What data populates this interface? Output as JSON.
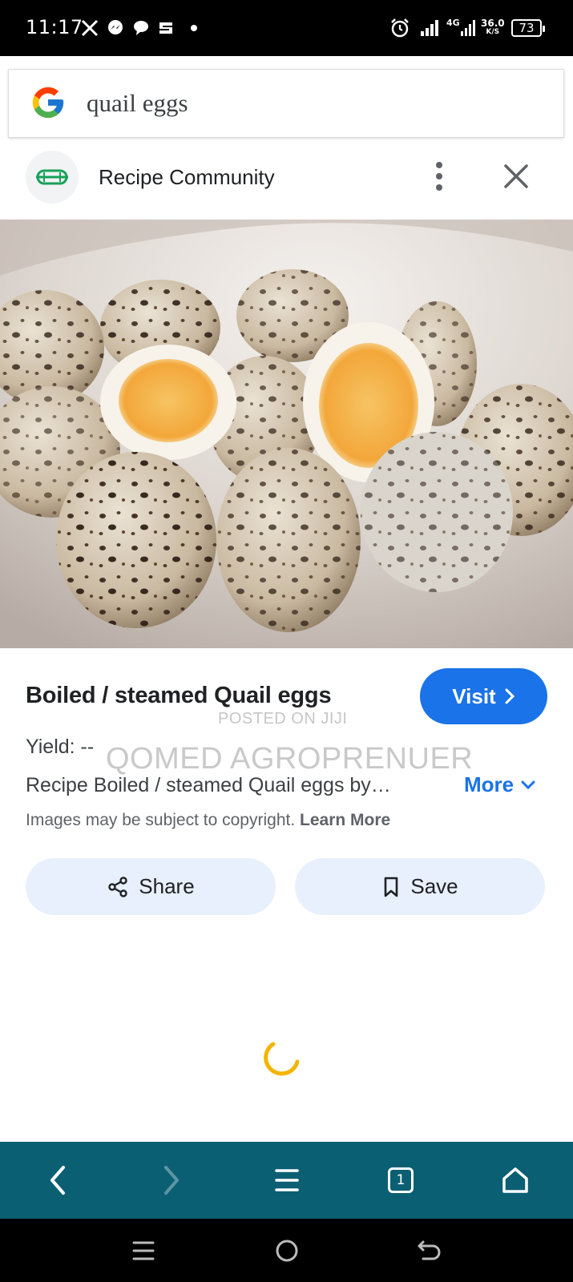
{
  "status_bar": {
    "time": "11:17",
    "network_type": "4G",
    "net_speed_value": "36.0",
    "net_speed_unit": "K/S",
    "battery": "73"
  },
  "search": {
    "query": "quail eggs"
  },
  "source": {
    "name": "Recipe Community"
  },
  "result": {
    "title": "Boiled / steamed Quail eggs",
    "visit_label": "Visit",
    "watermark_small": "POSTED ON JIJI",
    "watermark_large": "QOMED AGROPRENUER",
    "yield": "Yield: --",
    "description": "Recipe Boiled / steamed Quail eggs by…",
    "more_label": "More",
    "copyright_text": "Images may be subject to copyright.",
    "learn_more": "Learn More"
  },
  "actions": {
    "share_label": "Share",
    "save_label": "Save"
  },
  "browser_nav": {
    "tab_count": "1"
  },
  "colors": {
    "accent": "#1a73e8",
    "pill_bg": "#e8f0fe",
    "browser_bar": "#0b5f73",
    "spinner": "#f4b400"
  }
}
